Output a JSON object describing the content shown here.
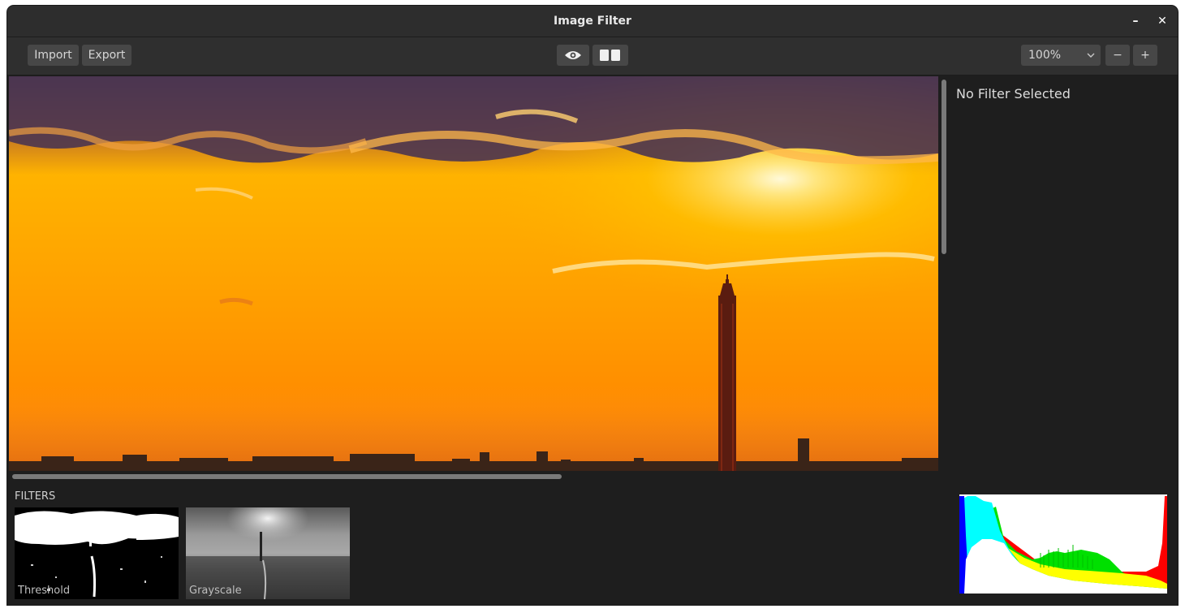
{
  "window": {
    "title": "Image Filter"
  },
  "titlebar_buttons": {
    "minimize": "–",
    "close": "✕"
  },
  "toolbar": {
    "import_label": "Import",
    "export_label": "Export",
    "zoom_value": "100%",
    "zoom_out_label": "−",
    "zoom_in_label": "+"
  },
  "side_panel": {
    "status": "No Filter Selected"
  },
  "filters": {
    "heading": "FILTERS",
    "items": [
      {
        "label": "Threshold"
      },
      {
        "label": "Grayscale"
      }
    ]
  },
  "colors": {
    "window_bg": "#242424",
    "button_bg": "#474747",
    "sky_top": "#5a3d66",
    "sky_mid": "#ff9d00",
    "sun": "#fff6c8"
  },
  "icons": [
    "eye-icon",
    "compare-icon",
    "chevron-down-icon"
  ]
}
